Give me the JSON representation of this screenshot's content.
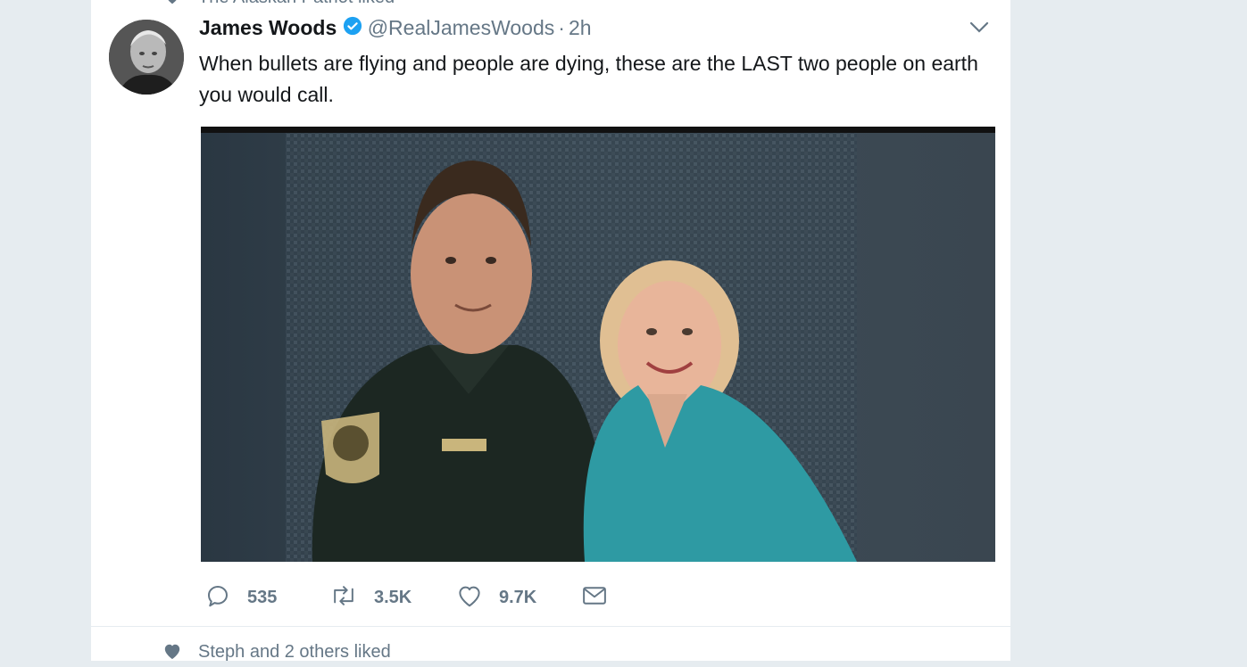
{
  "top_context": {
    "text": "The Alaskan Patriot liked"
  },
  "tweet": {
    "author_name": "James Woods",
    "handle": "@RealJamesWoods",
    "separator": "·",
    "time": "2h",
    "text": "When bullets are flying and people are dying, these are the LAST two people on earth you would call.",
    "media_description": "Photo of a uniformed sheriff standing next to a woman in a teal jacket",
    "actions": {
      "replies": "535",
      "retweets": "3.5K",
      "likes": "9.7K"
    }
  },
  "next_context": {
    "text": "Steph and 2 others liked"
  },
  "colors": {
    "background": "#e6ecf0",
    "text_primary": "#14171a",
    "text_secondary": "#657786",
    "verified": "#1da1f2"
  },
  "icons": [
    "heart-icon",
    "verified-badge-icon",
    "chevron-down-icon",
    "reply-icon",
    "retweet-icon",
    "like-icon",
    "message-icon"
  ]
}
